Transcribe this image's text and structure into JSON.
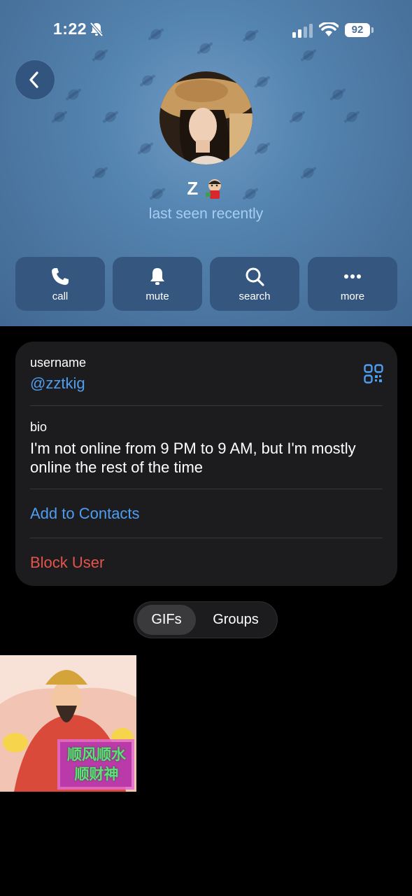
{
  "status_bar": {
    "time": "1:22",
    "battery": "92"
  },
  "profile": {
    "name": "Z",
    "last_seen": "last seen recently"
  },
  "actions": [
    {
      "label": "call",
      "icon": "phone-icon"
    },
    {
      "label": "mute",
      "icon": "bell-icon"
    },
    {
      "label": "search",
      "icon": "search-icon"
    },
    {
      "label": "more",
      "icon": "more-icon"
    }
  ],
  "info": {
    "username_label": "username",
    "username": "@zztkig",
    "bio_label": "bio",
    "bio": "I'm not online from 9 PM to 9 AM, but I'm mostly online the rest of the time",
    "add_contact": "Add to Contacts",
    "block": "Block User"
  },
  "tabs": {
    "items": [
      "GIFs",
      "Groups"
    ],
    "selected": "GIFs"
  },
  "gif": {
    "caption_line1": "顺风顺水",
    "caption_line2": "顺财神"
  },
  "colors": {
    "header_bg": "#4b76a1",
    "action_bg": "#35577f",
    "link": "#4f9df0",
    "destructive": "#e5534b",
    "card_bg": "#1c1c1e"
  }
}
